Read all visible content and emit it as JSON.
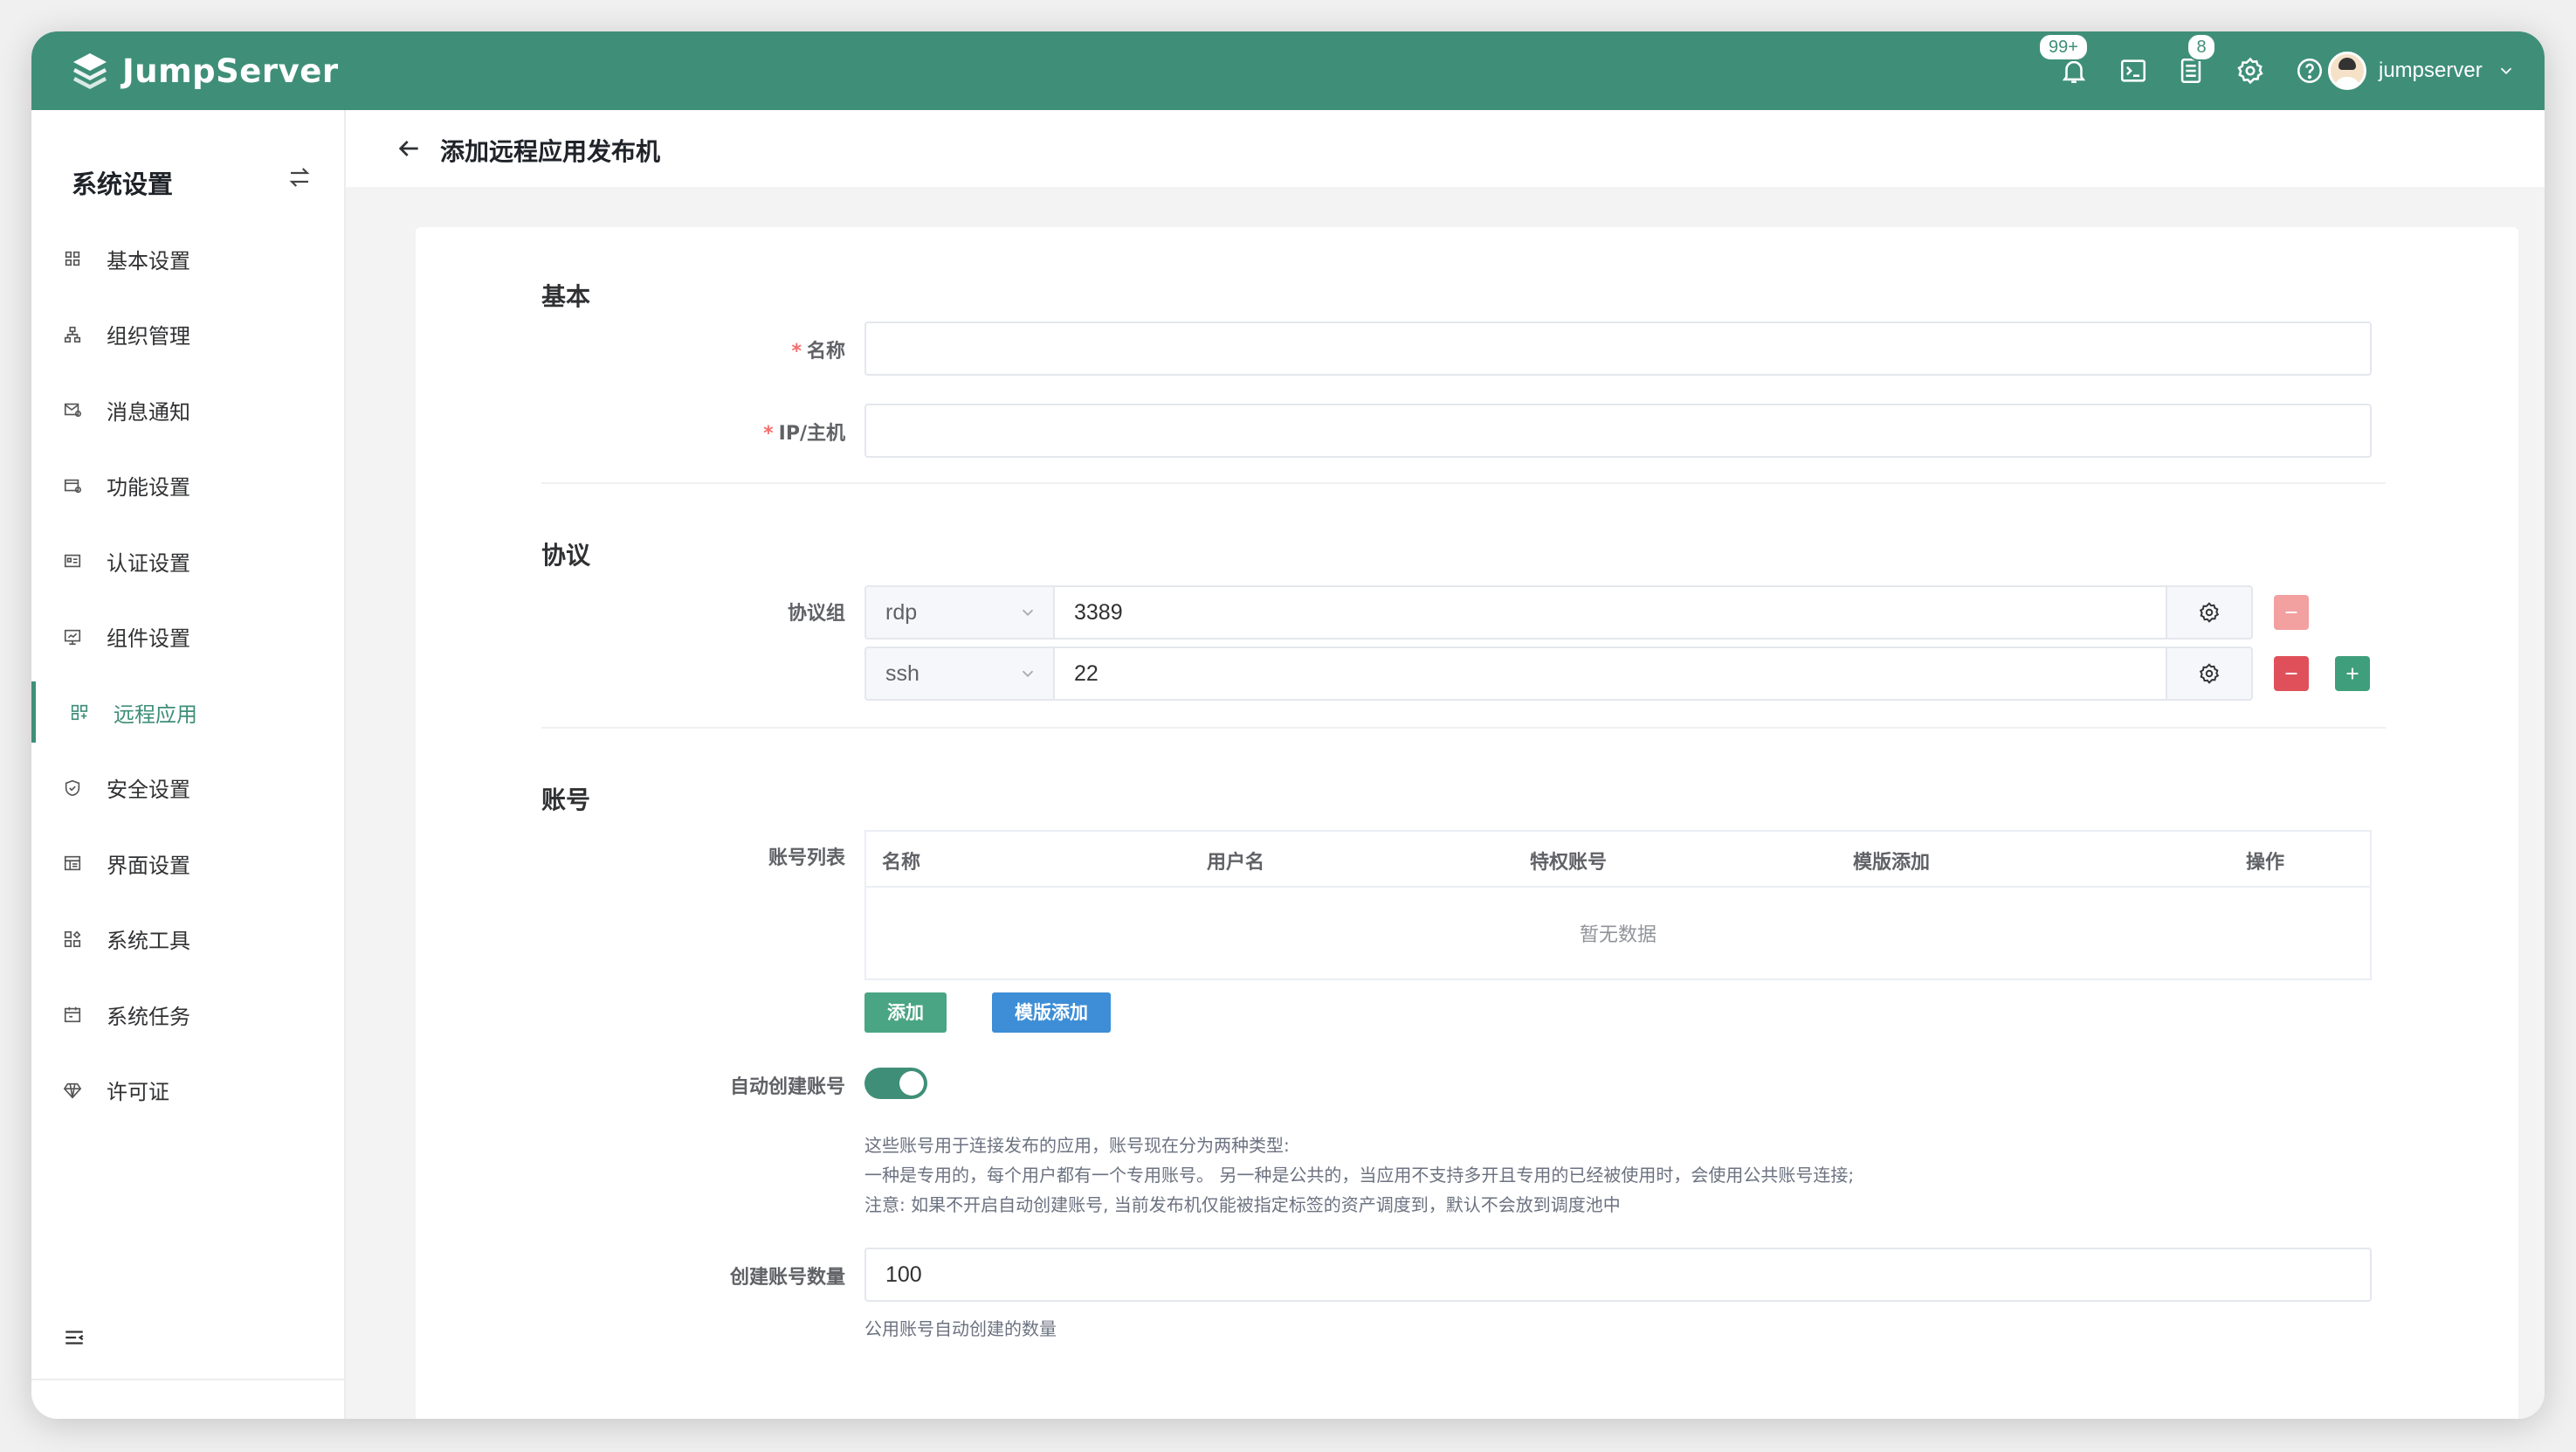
{
  "app": {
    "brand": "JumpServer",
    "notifications_badge": "99+",
    "tickets_badge": "8",
    "username": "jumpserver",
    "accent": "#3f8f78"
  },
  "sidebar": {
    "title": "系统设置",
    "items": [
      {
        "label": "基本设置",
        "icon": "grid-icon"
      },
      {
        "label": "组织管理",
        "icon": "org-tree-icon"
      },
      {
        "label": "消息通知",
        "icon": "message-icon"
      },
      {
        "label": "功能设置",
        "icon": "feature-icon"
      },
      {
        "label": "认证设置",
        "icon": "id-card-icon"
      },
      {
        "label": "组件设置",
        "icon": "monitor-icon"
      },
      {
        "label": "远程应用",
        "icon": "apps-icon",
        "active": true
      },
      {
        "label": "安全设置",
        "icon": "shield-icon"
      },
      {
        "label": "界面设置",
        "icon": "layout-icon"
      },
      {
        "label": "系统工具",
        "icon": "tools-icon"
      },
      {
        "label": "系统任务",
        "icon": "calendar-icon"
      },
      {
        "label": "许可证",
        "icon": "diamond-icon"
      }
    ]
  },
  "page": {
    "title": "添加远程应用发布机"
  },
  "form": {
    "basic": {
      "title": "基本",
      "name_label": "名称",
      "host_label": "IP/主机"
    },
    "protocol": {
      "title": "协议",
      "group_label": "协议组",
      "rows": [
        {
          "protocol": "rdp",
          "port": "3389"
        },
        {
          "protocol": "ssh",
          "port": "22"
        }
      ]
    },
    "account": {
      "title": "账号",
      "list_label": "账号列表",
      "columns": [
        "名称",
        "用户名",
        "特权账号",
        "模版添加",
        "操作"
      ],
      "empty_text": "暂无数据",
      "add_button": "添加",
      "template_add_button": "模版添加",
      "auto_create_label": "自动创建账号",
      "auto_create_enabled": true,
      "help_lines": [
        "这些账号用于连接发布的应用，账号现在分为两种类型:",
        "一种是专用的，每个用户都有一个专用账号。 另一种是公共的，当应用不支持多开且专用的已经被使用时，会使用公共账号连接;",
        "注意: 如果不开启自动创建账号, 当前发布机仅能被指定标签的资产调度到，默认不会放到调度池中"
      ],
      "count_label": "创建账号数量",
      "count_value": "100",
      "count_help": "公用账号自动创建的数量"
    }
  }
}
